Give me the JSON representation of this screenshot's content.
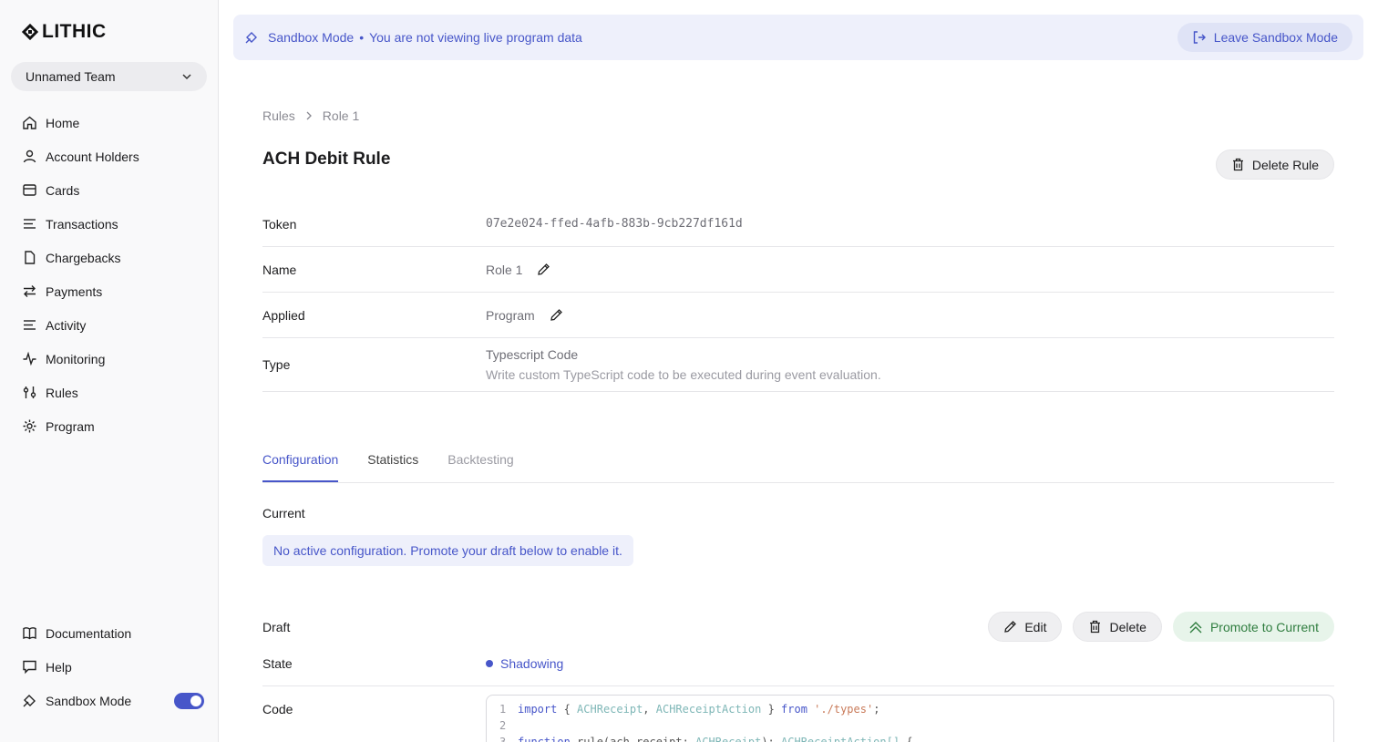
{
  "app": {
    "logo": "LITHIC",
    "team": "Unnamed Team"
  },
  "sidebar": {
    "items": [
      {
        "label": "Home",
        "icon": "home-icon"
      },
      {
        "label": "Account Holders",
        "icon": "user-icon"
      },
      {
        "label": "Cards",
        "icon": "card-icon"
      },
      {
        "label": "Transactions",
        "icon": "list-icon"
      },
      {
        "label": "Chargebacks",
        "icon": "file-icon"
      },
      {
        "label": "Payments",
        "icon": "arrows-icon"
      },
      {
        "label": "Activity",
        "icon": "list-icon"
      },
      {
        "label": "Monitoring",
        "icon": "pulse-icon"
      },
      {
        "label": "Rules",
        "icon": "sliders-icon"
      },
      {
        "label": "Program",
        "icon": "gear-icon"
      }
    ],
    "bottom": [
      {
        "label": "Documentation",
        "icon": "book-icon"
      },
      {
        "label": "Help",
        "icon": "chat-icon"
      },
      {
        "label": "Sandbox Mode",
        "icon": "sandbox-icon",
        "toggle": true
      }
    ]
  },
  "banner": {
    "title": "Sandbox Mode",
    "separator": "•",
    "message": "You are not viewing live program data",
    "leave_label": "Leave Sandbox Mode"
  },
  "breadcrumb": {
    "root": "Rules",
    "current": "Role 1"
  },
  "page": {
    "title": "ACH Debit Rule",
    "delete_label": "Delete Rule"
  },
  "details": {
    "token_label": "Token",
    "token_value": "07e2e024-ffed-4afb-883b-9cb227df161d",
    "name_label": "Name",
    "name_value": "Role 1",
    "applied_label": "Applied",
    "applied_value": "Program",
    "type_label": "Type",
    "type_value": "Typescript Code",
    "type_description": "Write custom TypeScript code to be executed during event evaluation."
  },
  "tabs": [
    {
      "label": "Configuration",
      "state": "active"
    },
    {
      "label": "Statistics",
      "state": "normal"
    },
    {
      "label": "Backtesting",
      "state": "disabled"
    }
  ],
  "current": {
    "label": "Current",
    "message": "No active configuration. Promote your draft below to enable it."
  },
  "draft": {
    "label": "Draft",
    "edit_label": "Edit",
    "delete_label": "Delete",
    "promote_label": "Promote to Current",
    "state_label": "State",
    "state_value": "Shadowing",
    "code_label": "Code"
  },
  "code": {
    "lines": [
      {
        "n": "1",
        "parts": [
          [
            "kw",
            "import"
          ],
          [
            "pl",
            " { "
          ],
          [
            "ty",
            "ACHReceipt"
          ],
          [
            "pl",
            ", "
          ],
          [
            "ty",
            "ACHReceiptAction"
          ],
          [
            "pl",
            " } "
          ],
          [
            "kw",
            "from"
          ],
          [
            "pl",
            " "
          ],
          [
            "str",
            "'./types'"
          ],
          [
            "pl",
            ";"
          ]
        ]
      },
      {
        "n": "2",
        "parts": []
      },
      {
        "n": "3",
        "parts": [
          [
            "kw",
            "function"
          ],
          [
            "pl",
            " rule(ach_receipt: "
          ],
          [
            "ty",
            "ACHReceipt"
          ],
          [
            "pl",
            "): "
          ],
          [
            "ty",
            "ACHReceiptAction[]"
          ],
          [
            "pl",
            " {"
          ]
        ]
      }
    ]
  },
  "colors": {
    "accent": "#4756c9",
    "banner_bg": "#eef0fb",
    "green": "#2f7d3f"
  }
}
